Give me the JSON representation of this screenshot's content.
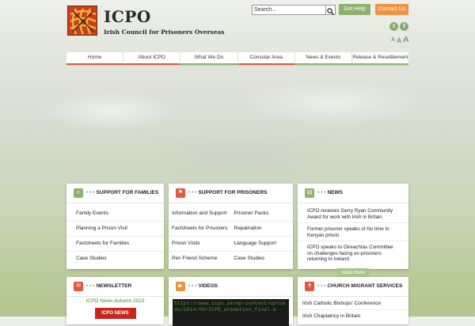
{
  "brand": {
    "title": "ICPO",
    "subtitle": "Irish Council  for Prisoners Overseas",
    "accent": "#c8401f"
  },
  "search": {
    "value": "Search..."
  },
  "header_buttons": {
    "help": "Get Help",
    "contact": "Contact Us"
  },
  "social": {
    "twitter": "t",
    "facebook": "f"
  },
  "font_size": {
    "small": "A",
    "medium": "A",
    "large": "A"
  },
  "nav": [
    {
      "label": "Home",
      "color": "#e4573d"
    },
    {
      "label": "About ICPO",
      "color": "#e4573d"
    },
    {
      "label": "What We Do",
      "color": "#8cb26e"
    },
    {
      "label": "Consular Area",
      "color": "#e4573d"
    },
    {
      "label": "News & Events",
      "color": "#8cb26e"
    },
    {
      "label": "Release & Resettlement",
      "color": "#8cb26e"
    }
  ],
  "families": {
    "title": "SUPPORT FOR FAMILIES",
    "items": [
      "Family Events",
      "Planning a Prison Visit",
      "Factsheets for Families",
      "Case Studies"
    ]
  },
  "prisoners": {
    "title": "SUPPORT FOR PRISONERS",
    "col1": [
      "Information and Support",
      "Factsheets for Prisoners",
      "Prison Visits",
      "Pen Friend Scheme"
    ],
    "col2": [
      "Prisoner Packs",
      "Repatriation",
      "Language Support",
      "Case Studies"
    ]
  },
  "news": {
    "title": "NEWS",
    "items": [
      "ICPO receives Gerry Ryan Community Award for work with Irish in Britain",
      "Former prisoner speaks of his time in Kenyan prison",
      "ICPO speaks to Oireachtas Committee on challenges facing ex-prisoners returning to Ireland"
    ],
    "read_more": "read more"
  },
  "newsletter": {
    "title": "NEWSLETTER",
    "link": "ICPO News Autumn 2023",
    "image_text": "ICPO NEWS"
  },
  "videos": {
    "title": "VIDEOS",
    "embed_url": "https://www.icpo.ie/wp-content/uploads/2014/09/ICPO_animation_final.m"
  },
  "church": {
    "title": "CHURCH MIGRANT SERVICES",
    "items": [
      "Irish Catholic Bishops' Conference",
      "Irish Chaplaincy in Britain"
    ]
  }
}
